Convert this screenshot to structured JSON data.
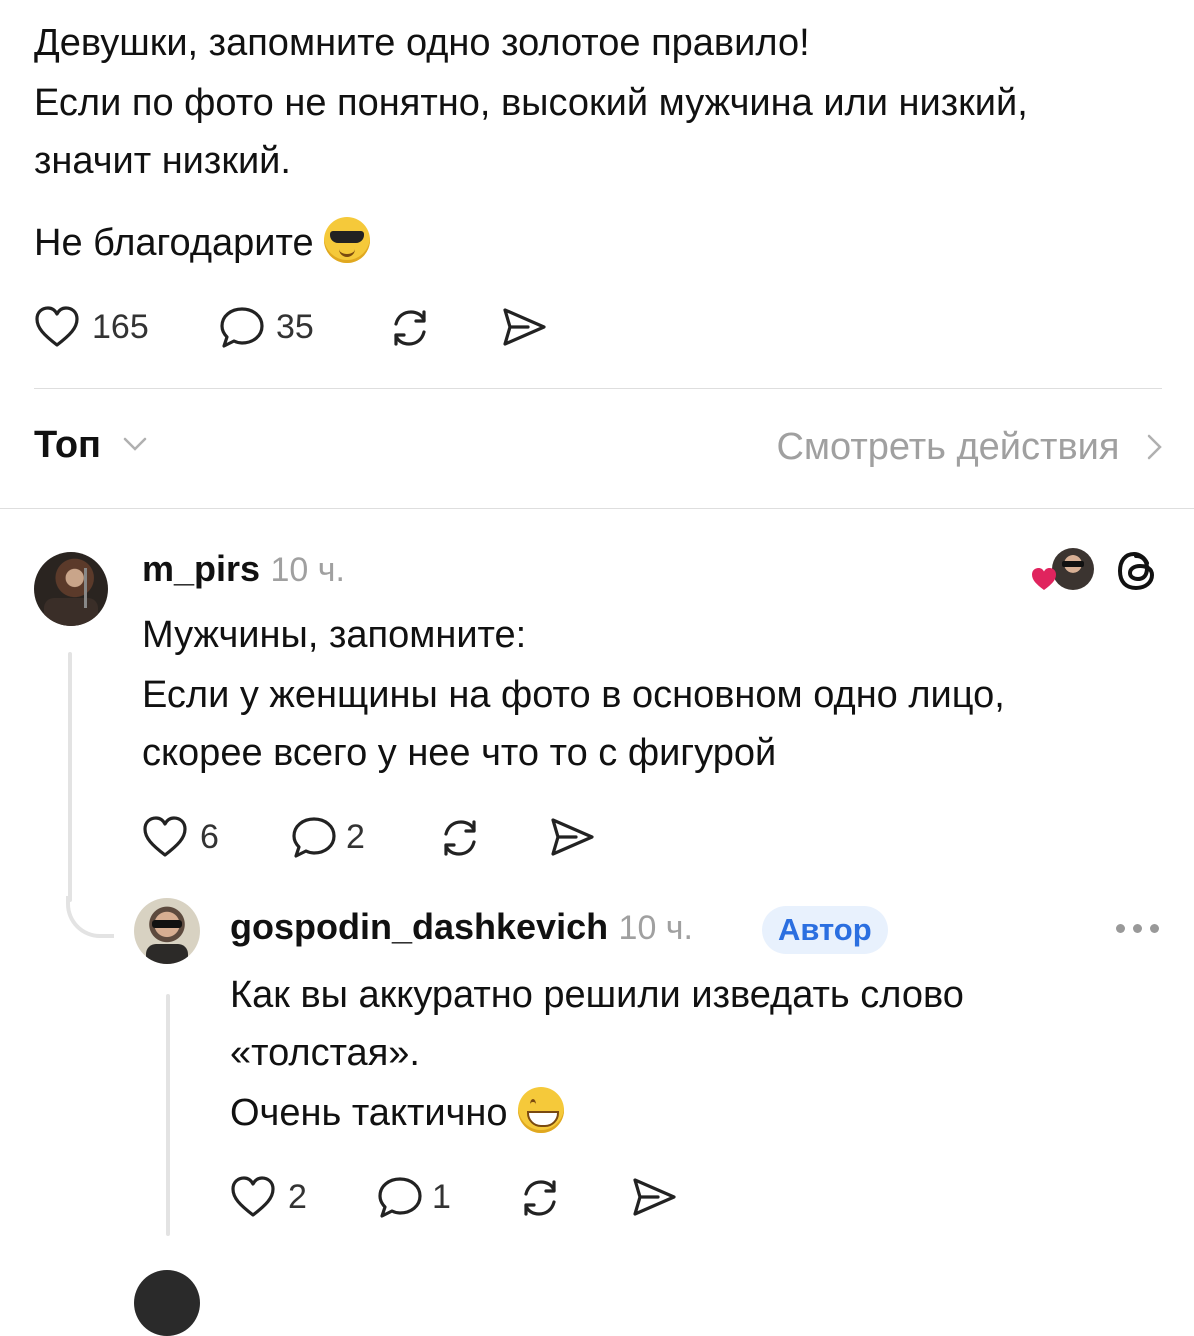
{
  "post": {
    "line1": "Девушки, запомните одно золотое правило!",
    "line2": "Если по фото не понятно, высокий мужчина или низкий,",
    "line3": "значит низкий.",
    "line4": "Не благодарите",
    "emoji": "smiling-face-with-sunglasses",
    "likes": "165",
    "replies": "35"
  },
  "sort": {
    "label": "Топ",
    "view_activity": "Смотреть действия"
  },
  "comments": [
    {
      "username": "m_pirs",
      "time": "10 ч.",
      "line1": "Мужчины, запомните:",
      "line2": "Если у женщины на фото в основном одно лицо,",
      "line3": "скорее всего у нее что то с фигурой",
      "likes": "6",
      "replies": "2"
    },
    {
      "username": "gospodin_dashkevich",
      "time": "10 ч.",
      "badge": "Автор",
      "line1": "Как вы аккуратно решили изведать слово",
      "line2": "«толстая».",
      "line3": "Очень тактично",
      "emoji": "grinning-face",
      "likes": "2",
      "replies": "1"
    }
  ],
  "colors": {
    "accent": "#2b6fe0",
    "badge_bg": "#e8f1fd",
    "like_heart": "#e0245e",
    "muted": "#a0a0a0"
  }
}
